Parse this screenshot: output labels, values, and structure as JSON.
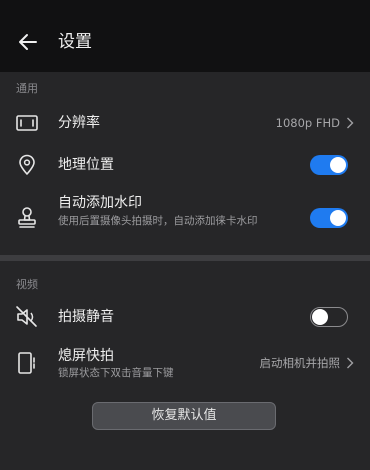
{
  "header": {
    "title": "设置",
    "back_icon": "arrow-left-icon"
  },
  "sections": {
    "general_label": "通用",
    "video_label": "视频"
  },
  "settings": {
    "resolution": {
      "icon": "resolution-icon",
      "title": "分辨率",
      "value": "1080p FHD"
    },
    "location": {
      "icon": "location-pin-icon",
      "title": "地理位置",
      "enabled": true
    },
    "watermark": {
      "icon": "stamp-icon",
      "title": "自动添加水印",
      "subtitle": "使用后置摄像头拍摄时，自动添加徕卡水印",
      "enabled": true
    },
    "mute_shutter": {
      "icon": "speaker-mute-icon",
      "title": "拍摄静音",
      "enabled": false
    },
    "quick_snap": {
      "icon": "phone-quick-icon",
      "title": "熄屏快拍",
      "subtitle": "锁屏状态下双击音量下键",
      "value": "启动相机并拍照"
    }
  },
  "reset_button": {
    "label": "恢复默认值"
  },
  "colors": {
    "accent": "#1f7bf0",
    "background": "#262628",
    "header": "#111112"
  }
}
